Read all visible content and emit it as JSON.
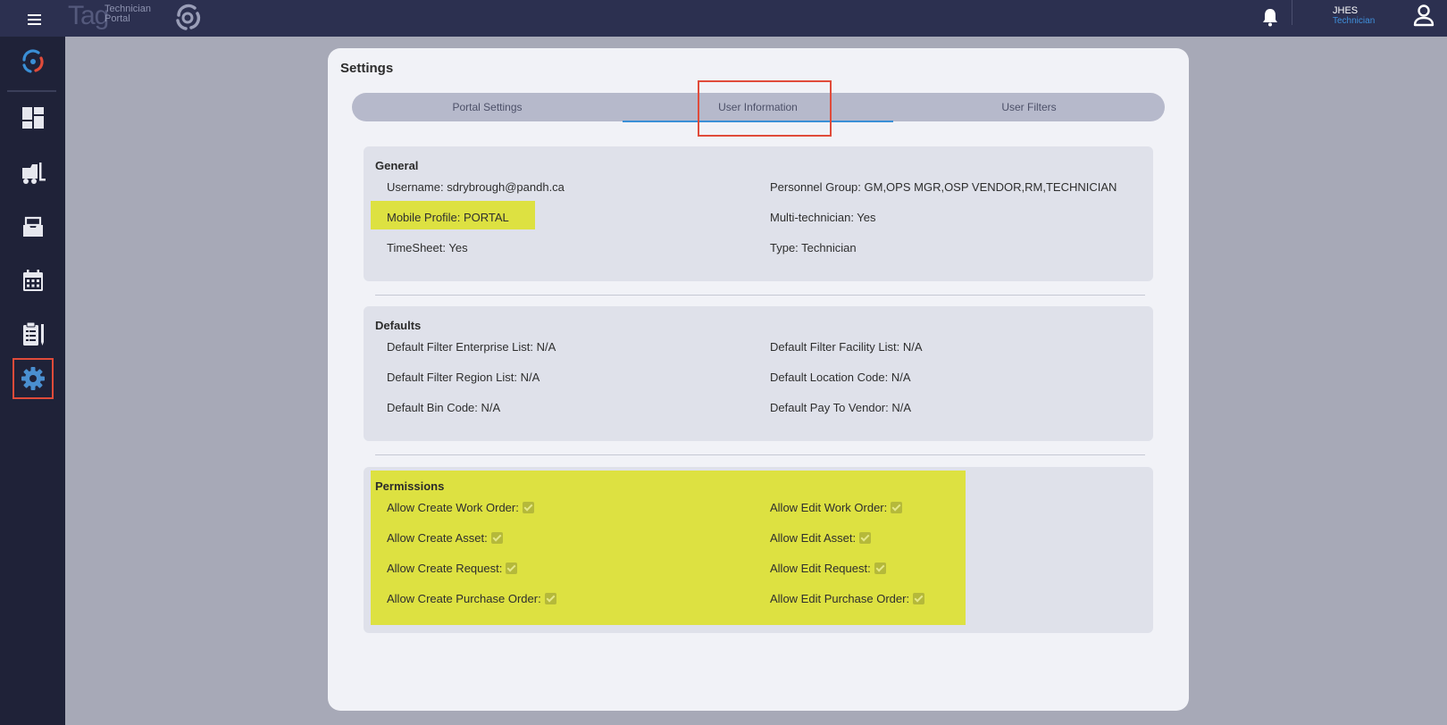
{
  "app": {
    "logo_main": "Tag",
    "logo_sub_line1": "Technician",
    "logo_sub_line2": "Portal"
  },
  "user": {
    "name": "JHES",
    "role": "Technician"
  },
  "sidebar": {
    "items": [
      {
        "icon": "swirl-logo-icon"
      },
      {
        "icon": "dashboard-icon"
      },
      {
        "icon": "truck-icon"
      },
      {
        "icon": "inbox-icon"
      },
      {
        "icon": "calendar-icon"
      },
      {
        "icon": "clipboard-icon"
      },
      {
        "icon": "gear-icon",
        "active": true
      }
    ]
  },
  "page": {
    "title": "Settings",
    "tabs": [
      {
        "label": "Portal Settings"
      },
      {
        "label": "User Information",
        "active": true
      },
      {
        "label": "User Filters"
      }
    ]
  },
  "general": {
    "title": "General",
    "username": "Username: sdrybrough@pandh.ca",
    "personnel_group": "Personnel Group: GM,OPS MGR,OSP VENDOR,RM,TECHNICIAN",
    "mobile_profile": "Mobile Profile: PORTAL",
    "multi_technician": "Multi-technician: Yes",
    "timesheet": "TimeSheet: Yes",
    "type": "Type: Technician"
  },
  "defaults": {
    "title": "Defaults",
    "enterprise_list": "Default Filter Enterprise List: N/A",
    "facility_list": "Default Filter Facility List: N/A",
    "region_list": "Default Filter Region List: N/A",
    "location_code": "Default Location Code: N/A",
    "bin_code": "Default Bin Code: N/A",
    "pay_to_vendor": "Default Pay To Vendor: N/A"
  },
  "permissions": {
    "title": "Permissions",
    "create_work_order": "Allow Create Work Order:",
    "edit_work_order": "Allow Edit Work Order:",
    "create_asset": "Allow Create Asset:",
    "edit_asset": "Allow Edit Asset:",
    "create_request": "Allow Create Request:",
    "edit_request": "Allow Edit Request:",
    "create_purchase_order": "Allow Create Purchase Order:",
    "edit_purchase_order": "Allow Edit Purchase Order:"
  },
  "colors": {
    "topbar": "#2c3050",
    "sidebar": "#1f2238",
    "accent_blue": "#3a8fd6",
    "highlight_yellow": "#dde141",
    "annotation_red": "#e04b3a"
  }
}
